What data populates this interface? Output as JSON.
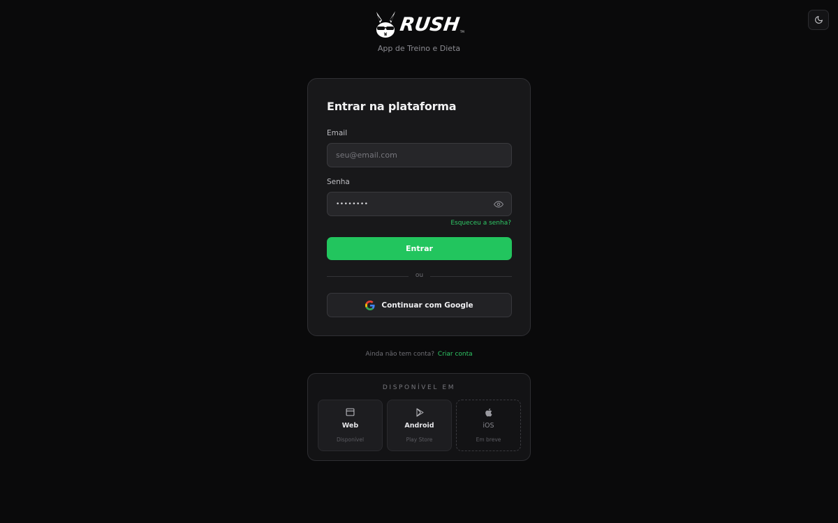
{
  "brand": {
    "name": "RUSH",
    "trademark": "TM",
    "tagline": "App de Treino e Dieta"
  },
  "login": {
    "title": "Entrar na plataforma",
    "email_label": "Email",
    "email_placeholder": "seu@email.com",
    "password_label": "Senha",
    "password_value": "••••••••",
    "forgot_link": "Esqueceu a senha?",
    "submit_label": "Entrar",
    "divider_text": "ou",
    "google_label": "Continuar com Google"
  },
  "signup": {
    "prompt": "Ainda não tem conta?",
    "link": "Criar conta"
  },
  "platforms": {
    "title": "DISPONÍVEL EM",
    "items": [
      {
        "name": "Web",
        "status": "Disponível",
        "icon": "browser-icon"
      },
      {
        "name": "Android",
        "status": "Play Store",
        "icon": "play-store-icon"
      },
      {
        "name": "iOS",
        "status": "Em breve",
        "icon": "apple-icon"
      }
    ]
  },
  "colors": {
    "background": "#0a0a0b",
    "card": "#18181a",
    "accent": "#22c55e",
    "link": "#2fc765"
  },
  "icons": {
    "theme_toggle": "moon-icon",
    "password_visibility": "eye-icon",
    "google": "google-icon",
    "logo": "rabbit-logo-icon"
  }
}
